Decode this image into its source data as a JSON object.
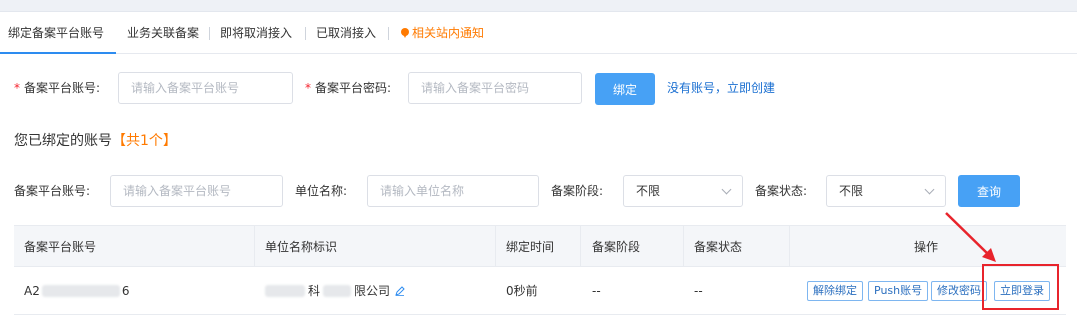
{
  "tabs": [
    {
      "label": "绑定备案平台账号",
      "active": true
    },
    {
      "label": "业务关联备案",
      "active": false
    },
    {
      "label": "即将取消接入",
      "active": false
    },
    {
      "label": "已取消接入",
      "active": false
    },
    {
      "label": "相关站内通知",
      "active": false
    }
  ],
  "bind_form": {
    "account_label": "备案平台账号:",
    "account_placeholder": "请输入备案平台账号",
    "password_label": "备案平台密码:",
    "password_placeholder": "请输入备案平台密码",
    "bind_button": "绑定",
    "create_link": "没有账号，立即创建"
  },
  "bound_section": {
    "title": "您已绑定的账号",
    "count": "【共1个】"
  },
  "filters": {
    "account_label": "备案平台账号:",
    "account_placeholder": "请输入备案平台账号",
    "unit_label": "单位名称:",
    "unit_placeholder": "请输入单位名称",
    "stage_label": "备案阶段:",
    "stage_value": "不限",
    "status_label": "备案状态:",
    "status_value": "不限",
    "query_button": "查询"
  },
  "table": {
    "headers": [
      "备案平台账号",
      "单位名称标识",
      "绑定时间",
      "备案阶段",
      "备案状态",
      "操作"
    ],
    "row": {
      "account_prefix": "A2",
      "account_suffix": "6",
      "unit_mid": "科",
      "unit_suffix": "限公司",
      "bind_time": "0秒前",
      "stage": "--",
      "status": "--",
      "actions": [
        "解除绑定",
        "Push账号",
        "修改密码",
        "立即登录"
      ]
    }
  },
  "colors": {
    "primary": "#47a1f5",
    "accent_orange": "#ff7a00",
    "annotation_red": "#e8242c",
    "link_blue": "#1a6fd1"
  }
}
